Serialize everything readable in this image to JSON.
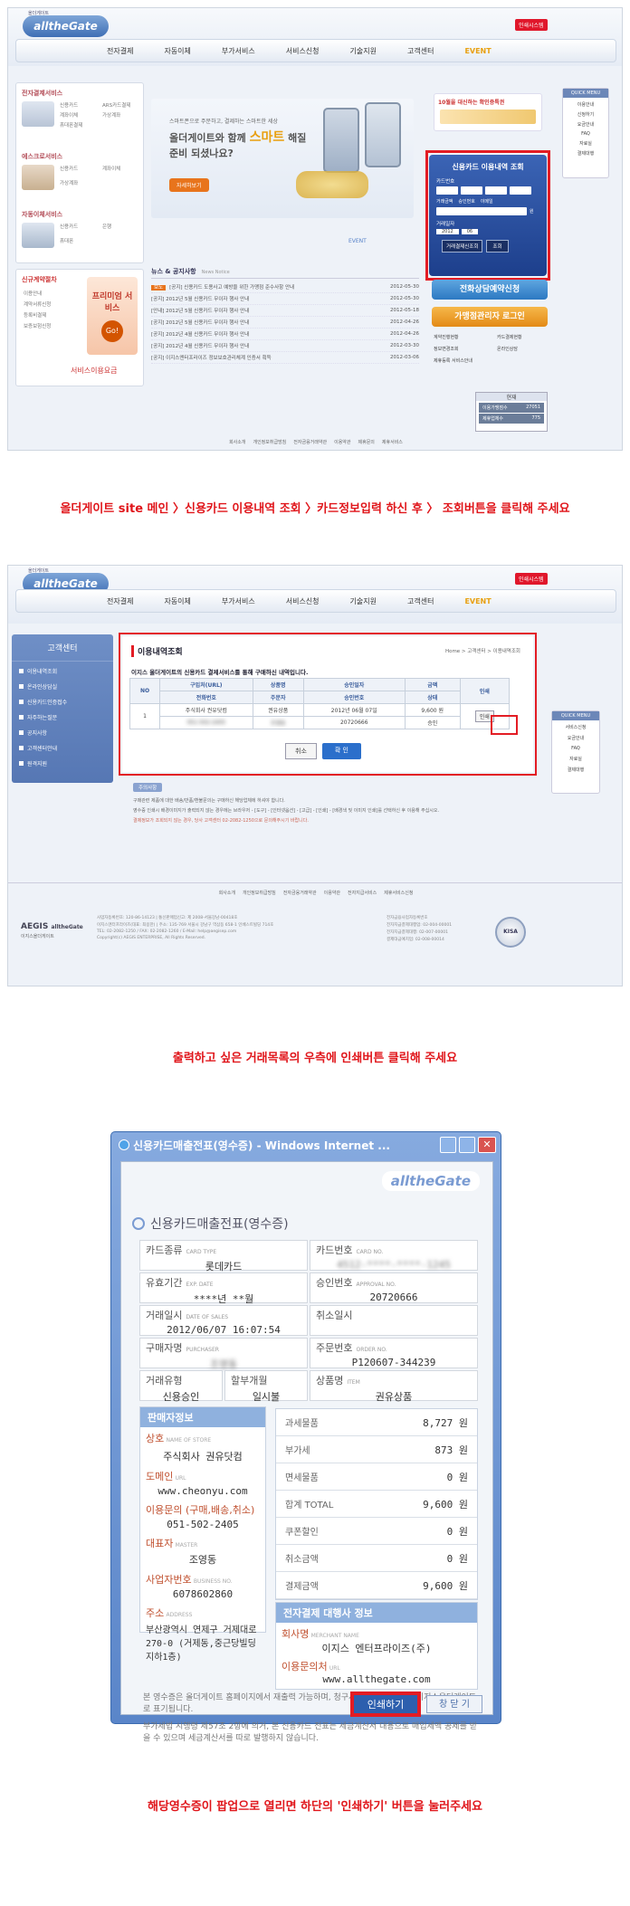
{
  "shot1": {
    "logo_top": "올더게이트",
    "logo": "alltheGate",
    "top_button": "인쇄시스템",
    "nav": [
      "전자결제",
      "자동이체",
      "부가서비스",
      "서비스신청",
      "기술지원",
      "고객센터",
      "EVENT"
    ],
    "services": [
      {
        "title": "전자결제서비스",
        "items": [
          "신용카드",
          "ARS카드결제",
          "계좌이체",
          "가상계좌",
          "휴대폰결제"
        ]
      },
      {
        "title": "에스크로서비스",
        "items": [
          "신용카드",
          "계좌이체",
          "가상계좌"
        ]
      },
      {
        "title": "자동이체서비스",
        "items": [
          "신용카드",
          "은행",
          "휴대폰"
        ]
      }
    ],
    "signup": {
      "title": "신규계약절차",
      "items": [
        "이용안내",
        "계약서류신청",
        "등록비결제",
        "보증보험신청"
      ],
      "promo": "프리미엄 서비스",
      "go": "Go!",
      "fee": "서비스이용요금"
    },
    "banner": {
      "line1": "스마트폰으로 주문하고, 결제하는 스마트한 세상",
      "line2": "올더게이트와 함께",
      "highlight": "스마트",
      "line3": "해질",
      "line4": "준비 되셨나요?",
      "button": "자세히보기"
    },
    "event_tab": "EVENT",
    "news": {
      "title": "뉴스 & 공지사항",
      "more": "News Notice",
      "badge": "보도",
      "items": [
        {
          "text": "[공지] 신용카드 도용사고 예방을 위한 가맹점 준수사항 안내",
          "date": "2012-05-30"
        },
        {
          "text": "[공지] 2012년 5월 신용카드 무이자 행사 안내",
          "date": "2012-05-30"
        },
        {
          "text": "[안내] 2012년 5월 신용카드 무이자 행사 안내",
          "date": "2012-05-18"
        },
        {
          "text": "[공지] 2012년 5월 신용카드 무이자 행사 안내",
          "date": "2012-04-26"
        },
        {
          "text": "[공지] 2012년 4월 신용카드 무이자 행사 안내",
          "date": "2012-04-26"
        },
        {
          "text": "[공지] 2012년 4월 신용카드 무이자 행사 안내",
          "date": "2012-03-30"
        },
        {
          "text": "[공지] 이지스엔터프라이즈 정보보호관리체계 인증서 획득",
          "date": "2012-03-06"
        }
      ]
    },
    "promo_right": "10월을 대신하는 확인증특권",
    "card_query": {
      "title": "신용카드 이용내역 조회",
      "card_label": "카드번호",
      "radios": [
        "거래금액",
        "승인번호",
        "이메일"
      ],
      "won": "원",
      "date_label": "거래일자",
      "year": "2012",
      "month": "06",
      "btn1": "거래결제신조회",
      "btn2": "조회"
    },
    "phone_btn": "전화상담예약신청",
    "merchant_btn": "가맹점관리자 로그인",
    "links": [
      "계약진행현황",
      "카드결제현황",
      "정보변경조회",
      "온라인상담",
      "제휴등록 서비스안내"
    ],
    "today": {
      "title": "현재",
      "r1k": "이용가맹점수",
      "r1v": "27051",
      "r2k": "제휴업체수",
      "r2v": "775"
    },
    "quick": {
      "title": "QUICK MENU",
      "items": [
        "이용안내",
        "신청하기",
        "요금안내",
        "FAQ",
        "자료실",
        "결제대행"
      ]
    },
    "footer": [
      "회사소개",
      "개인정보취급방침",
      "전자금융거래약관",
      "이용약관",
      "제휴문의",
      "제휴서비스"
    ]
  },
  "caption1": "올더게이트 site 메인 〉신용카드 이용내역 조회 〉카드정보입력  하신 후  〉 조회버튼을 클릭해 주세요",
  "shot2": {
    "sidebar_title": "고객센터",
    "sidebar": [
      "이용내역조회",
      "온라인상담실",
      "신용카드인증접수",
      "자주하는질문",
      "공지사항",
      "고객센터안내",
      "원격지원"
    ],
    "page_title": "이용내역조회",
    "breadcrumb": "Home > 고객센터 > 이용내역조회",
    "notice": "이지스 올더게이트의 신용카드 결제서비스를 통해 구매하신 내역입니다.",
    "head1": [
      "NO",
      "구입처(URL)",
      "상품명",
      "승인일자",
      "금액",
      "인쇄"
    ],
    "head2": [
      "전화번호",
      "주문자",
      "승인번호",
      "상태"
    ],
    "row": {
      "no": "1",
      "shop": "주식회사 권유닷컴",
      "phone": "051-502-2405",
      "product": "권유상품",
      "orderer": "조영동",
      "date": "2012년 06월 07일",
      "approval": "20720666",
      "amount": "9,600 원",
      "status": "승인",
      "print": "인쇄"
    },
    "back": "취소",
    "ok": "확 인",
    "notes_title": "주의사항",
    "notes": [
      "구매관련 제품에 대한 배송/반품/환불문의는 구매하신 해당업체에 하셔야 합니다.",
      "영수증 인쇄시 배경이미지가 출력되지 않는 경우에는 브라우저 - [도구] - [인터넷옵션] - [고급] - [인쇄] - [배경색 및 이미지 인쇄]를 선택하신 후 이용해 주십시오.",
      "결제정보가 조회되지 않는 경우, 당사 고객센터 02-2082-1250으로 문의해주시기 바랍니다."
    ],
    "footer_links": [
      "회사소개",
      "개인정보취급방침",
      "전자금융거래약관",
      "이용약관",
      "전자지급서비스",
      "제휴서비스신청"
    ],
    "company": "이지스올더게이트",
    "footer_addr": [
      "사업자등록번호: 120-86-14123 | 통신판매업신고: 제 2008-서울강남-00418호",
      "이지스엔터프라이즈(대표: 최용한) | 주소: 135-769 서울시 강남구 역삼동 658-1 인베스트빌딩 714호",
      "TEL: 02-2082-1250 / FAX: 02-2082-1260 / E-Mail: help@aegisep.com",
      "Copyright(c) AEGIS ENTERPRISE, All Rights Reserved."
    ],
    "footer_right": [
      "전자금융사업자등록번호",
      "전자지급결제대행업: 02-004-00001",
      "전자지급결제대행: 02-007-00001",
      "결제대금예치업: 02-008-00014"
    ],
    "badge": "KISA",
    "quick": {
      "title": "QUICK MENU",
      "items": [
        "서비스신청",
        "요금안내",
        "FAQ",
        "자료실",
        "결제대행"
      ]
    }
  },
  "caption2": "출력하고 싶은 거래목록의 우측에 인쇄버튼 클릭해 주세요",
  "popup": {
    "window_title": "신용카드매출전표(영수증) - Windows Internet ...",
    "logo": "alltheGate",
    "heading": "신용카드매출전표(영수증)",
    "card_type_k": "카드종류",
    "card_type_e": "CARD TYPE",
    "card_type_v": "롯데카드",
    "card_no_k": "카드번호",
    "card_no_e": "CARD NO.",
    "card_no_v": "4512-****-****-1245",
    "exp_k": "유효기간",
    "exp_e": "EXP. DATE",
    "exp_v": "****년 **월",
    "appr_k": "승인번호",
    "appr_e": "APPROVAL NO.",
    "appr_v": "20720666",
    "date_k": "거래일시",
    "date_e": "DATE OF SALES",
    "date_v": "2012/06/07 16:07:54",
    "cancel_k": "취소일시",
    "buyer_k": "구매자명",
    "buyer_e": "PURCHASER",
    "buyer_v": "조영동",
    "order_k": "주문번호",
    "order_e": "ORDER NO.",
    "order_v": "P120607-344239",
    "type_k": "거래유형",
    "type_v": "신용승인",
    "inst_k": "할부개월",
    "inst_v": "일시불",
    "item_k": "상품명",
    "item_e": "ITEM",
    "item_v": "권유상품",
    "seller_head": "판매자정보",
    "store_k": "상호",
    "store_e": "NAME OF STORE",
    "store_v": "주식회사 권유닷컴",
    "url_k": "도메인",
    "url_e": "URL",
    "url_v": "www.cheonyu.com",
    "contact_k": "이용문의 (구매,배송,취소)",
    "contact_v": "051-502-2405",
    "master_k": "대표자",
    "master_e": "MASTER",
    "master_v": "조영동",
    "biz_k": "사업자번호",
    "biz_e": "BUSINESS NO.",
    "biz_v": "6078602860",
    "addr_k": "주소",
    "addr_e": "ADDRESS",
    "addr_v": "부산광역시 연제구 거제대로270-0 (거제동,중근당빌딩지하1층)",
    "amounts": [
      {
        "k": "과세물품",
        "v": "8,727 원"
      },
      {
        "k": "부가세",
        "v": "873 원"
      },
      {
        "k": "면세물품",
        "v": "0 원"
      },
      {
        "k": "합계 TOTAL",
        "v": "9,600 원"
      },
      {
        "k": "쿠폰할인",
        "v": "0 원"
      },
      {
        "k": "취소금액",
        "v": "0 원"
      },
      {
        "k": "결제금액",
        "v": "9,600 원"
      }
    ],
    "pg_head": "전자결제 대행사 정보",
    "pg_name_k": "회사명",
    "pg_name_e": "MERCHANT NAME",
    "pg_name_v": "이지스 엔터프라이즈(주)",
    "pg_url_k": "이용문의처",
    "pg_url_e": "URL",
    "pg_url_v": "www.allthegate.com",
    "notes": [
      "본 영수증은 올더게이트 홈페이지에서 재출력 가능하며, 청구서에는 이지스 또는 이지스올더게이트로 표기됩니다.",
      "부가세법 시행령 제57조 2항에 의거, 본 신용카드 전표는 세금계산서 대용으로 매입세액 공제를 받을 수 있으며 세금계산서를 따로 발행하지 않습니다."
    ],
    "print_btn": "인쇄하기",
    "close_btn": "창 닫 기"
  },
  "caption3": "해당영수증이 팝업으로 열리면 하단의 '인쇄하기' 버튼을 눌러주세요"
}
